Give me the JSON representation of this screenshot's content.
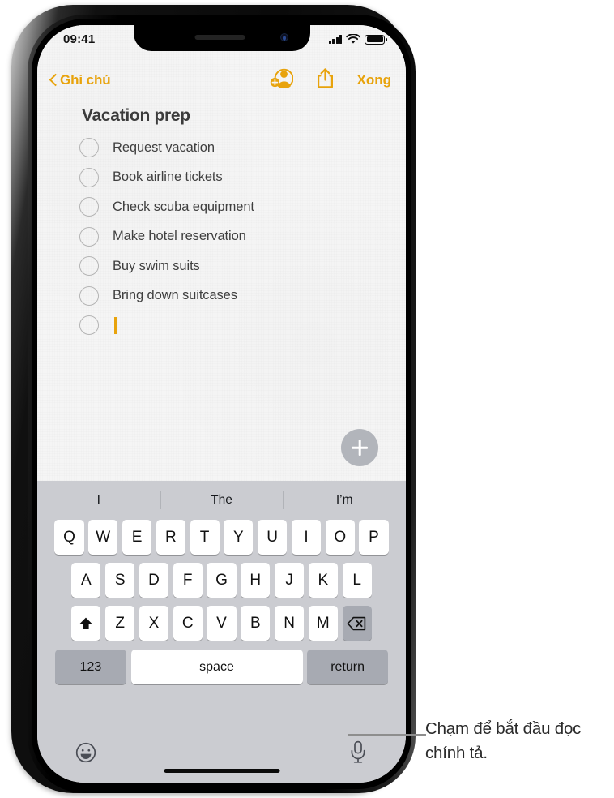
{
  "status_bar": {
    "time": "09:41",
    "signal_icon": "cellular-bars-icon",
    "wifi_icon": "wifi-icon",
    "battery_icon": "battery-full-icon"
  },
  "nav_bar": {
    "back_label": "Ghi chú",
    "back_icon": "chevron-left-icon",
    "collaborate_icon": "add-person-icon",
    "share_icon": "share-icon",
    "done_label": "Xong"
  },
  "note": {
    "title": "Vacation prep",
    "checklist": [
      {
        "label": "Request vacation",
        "checked": false
      },
      {
        "label": "Book airline tickets",
        "checked": false
      },
      {
        "label": "Check scuba equipment",
        "checked": false
      },
      {
        "label": "Make hotel reservation",
        "checked": false
      },
      {
        "label": "Buy swim suits",
        "checked": false
      },
      {
        "label": "Bring down suitcases",
        "checked": false
      },
      {
        "label": "",
        "checked": false,
        "active": true
      }
    ],
    "add_button_icon": "plus-icon"
  },
  "keyboard": {
    "suggestions": [
      "I",
      "The",
      "I’m"
    ],
    "row1": [
      "Q",
      "W",
      "E",
      "R",
      "T",
      "Y",
      "U",
      "I",
      "O",
      "P"
    ],
    "row2": [
      "A",
      "S",
      "D",
      "F",
      "G",
      "H",
      "J",
      "K",
      "L"
    ],
    "row3_shift_icon": "shift-arrow-icon",
    "row3": [
      "Z",
      "X",
      "C",
      "V",
      "B",
      "N",
      "M"
    ],
    "row3_backspace_icon": "backspace-icon",
    "numbers_label": "123",
    "space_label": "space",
    "return_label": "return",
    "emoji_icon": "emoji-smiley-icon",
    "dictation_icon": "microphone-icon"
  },
  "callout": {
    "text": "Chạm để bắt đầu đọc chính tả."
  },
  "colors": {
    "accent": "#e8a30c",
    "note_background": "#f5f5f5",
    "keyboard_background": "#cbccd1",
    "key_white": "#ffffff",
    "key_gray": "#a7aab2",
    "text_primary": "#3f3f3f"
  }
}
